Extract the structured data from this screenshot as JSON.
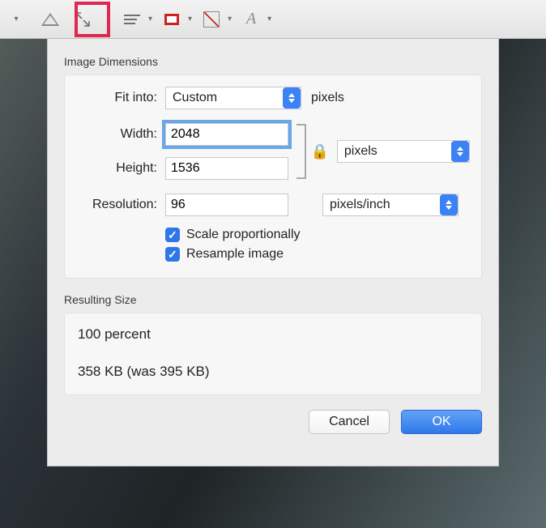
{
  "toolbar": {
    "font_letter": "A"
  },
  "dialog": {
    "section": "Image Dimensions",
    "fit_label": "Fit into:",
    "fit_value": "Custom",
    "fit_units": "pixels",
    "width_label": "Width:",
    "width_value": "2048",
    "height_label": "Height:",
    "height_value": "1536",
    "dim_units": "pixels",
    "res_label": "Resolution:",
    "res_value": "96",
    "res_units": "pixels/inch",
    "scale_check": "Scale proportionally",
    "resample_check": "Resample image",
    "result_section": "Resulting Size",
    "result_percent": "100 percent",
    "result_bytes": "358 KB (was 395 KB)",
    "cancel": "Cancel",
    "ok": "OK"
  }
}
